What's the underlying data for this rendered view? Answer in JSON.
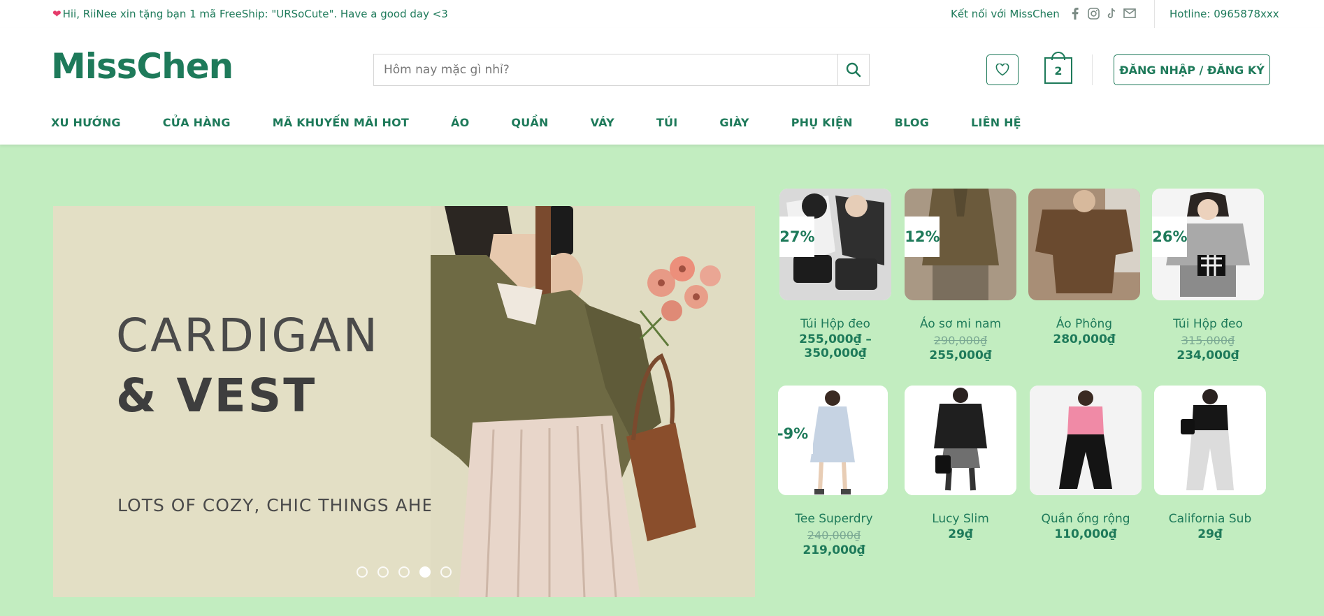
{
  "topbar": {
    "promo": "Hii, RiiNee xin tặng bạn 1 mã FreeShip: \"URSoCute\". Have a good day <3",
    "connect": "Kết nối với MissChen",
    "hotline": "Hotline: 0965878xxx",
    "socials": [
      "facebook-icon",
      "instagram-icon",
      "tiktok-icon",
      "mail-icon"
    ]
  },
  "header": {
    "logo": "MissChen",
    "search_placeholder": "Hôm nay mặc gì nhỉ?",
    "cart_count": "2",
    "login_label": "ĐĂNG NHẬP / ĐĂNG KÝ"
  },
  "nav": [
    "XU HƯỚNG",
    "CỬA HÀNG",
    "MÃ KHUYẾN MÃI HOT",
    "ÁO",
    "QUẦN",
    "VÁY",
    "TÚI",
    "GIÀY",
    "PHỤ KIỆN",
    "BLOG",
    "LIÊN HỆ"
  ],
  "hero": {
    "line1": "CARDIGAN",
    "line2": "& VEST",
    "tagline": "LOTS OF COZY, CHIC THINGS AHEAD",
    "slide_count": 5,
    "active_slide": 4
  },
  "products": [
    {
      "name": "Túi Hộp đeo",
      "badge": "-27%",
      "old_price": "",
      "price": "255,000₫ – 350,000₫"
    },
    {
      "name": "Áo sơ mi nam",
      "badge": "-12%",
      "old_price": "290,000₫",
      "price": "255,000₫"
    },
    {
      "name": "Áo Phông",
      "badge": "",
      "old_price": "",
      "price": "280,000₫"
    },
    {
      "name": "Túi Hộp đeo",
      "badge": "-26%",
      "old_price": "315,000₫",
      "price": "234,000₫"
    },
    {
      "name": "Tee Superdry",
      "badge": "-9%",
      "old_price": "240,000₫",
      "price": "219,000₫"
    },
    {
      "name": "Lucy Slim",
      "badge": "",
      "old_price": "",
      "price": "29₫"
    },
    {
      "name": "Quần ống rộng",
      "badge": "",
      "old_price": "",
      "price": "110,000₫"
    },
    {
      "name": "California Sub",
      "badge": "",
      "old_price": "",
      "price": "29₫"
    }
  ],
  "colors": {
    "brand": "#1e7a5a",
    "page_bg": "#c2edc0",
    "hero_bg": "#e3dfc5"
  }
}
